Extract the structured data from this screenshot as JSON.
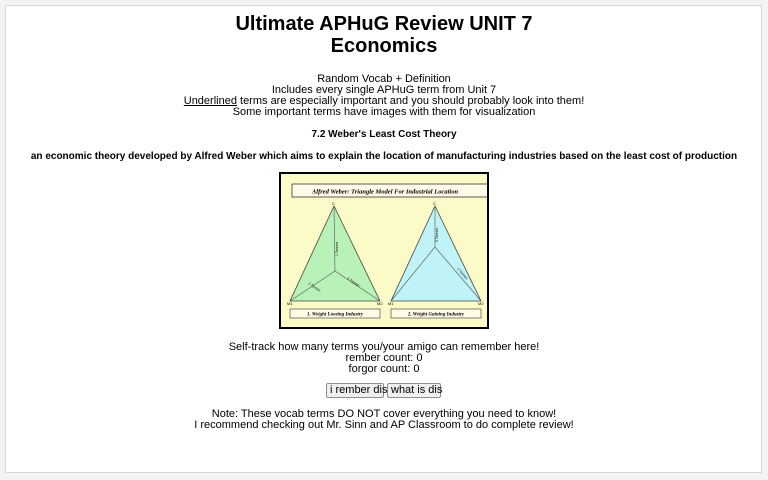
{
  "title_line1": "Ultimate APHuG Review UNIT 7",
  "title_line2": "Economics",
  "intro": {
    "line1": "Random Vocab + Definition",
    "line2": "Includes every single APHuG term from Unit 7",
    "underlined_word": "Underlined",
    "line3_rest": " terms are especially important and you should probably look into them!",
    "line4": "Some important terms have images with them for visualization"
  },
  "term": {
    "name": "7.2 Weber's Least Cost Theory",
    "definition": "an economic theory developed by Alfred Weber which aims to explain the location of manufacturing industries based on the least cost of production"
  },
  "diagram": {
    "heading": "Alfred Weber: Triangle Model For Industrial Location",
    "left_caption": "1. Weight Loosing Industry",
    "right_caption": "2. Weight Gaining Industry",
    "vertex_top": "C",
    "vertex_left": "M1",
    "vertex_right": "M2",
    "left_seg_top": "1 Tonnes",
    "left_seg_left": "1 Tonnes",
    "left_seg_right": "1 Tonnes",
    "right_seg_top": "2 Tonnes",
    "right_seg_right": "1 Tonnes",
    "colors": {
      "left_fill": "#b9f2b9",
      "right_fill": "#bff3f7",
      "background": "#fbfbc8"
    }
  },
  "tracker": {
    "line1": "Self-track how many terms you/your amigo can remember here!",
    "rember_label": "rember count:",
    "rember_count": "0",
    "forgor_label": "forgor count:",
    "forgor_count": "0"
  },
  "buttons": {
    "remember": "i rember dis",
    "what": "what is dis"
  },
  "note": {
    "line1": "Note: These vocab terms DO NOT cover everything you need to know!",
    "line2": "I recommend checking out Mr. Sinn and AP Classroom to do complete review!"
  }
}
